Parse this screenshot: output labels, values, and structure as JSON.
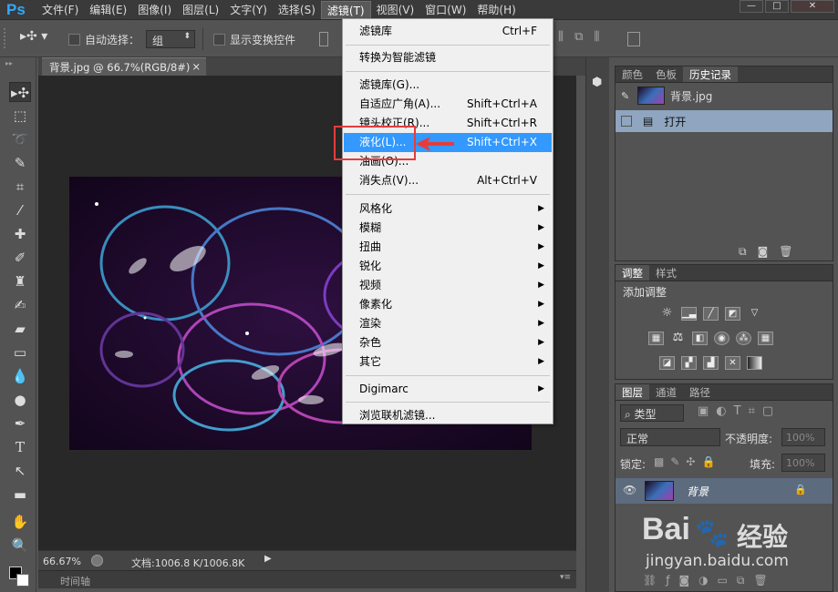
{
  "app": {
    "logo": "Ps"
  },
  "menubar": {
    "items": [
      "文件(F)",
      "编辑(E)",
      "图像(I)",
      "图层(L)",
      "文字(Y)",
      "选择(S)",
      "滤镜(T)",
      "视图(V)",
      "窗口(W)",
      "帮助(H)"
    ],
    "active_index": 6,
    "window_buttons": [
      "—",
      "□",
      "✕"
    ]
  },
  "options_bar": {
    "auto_select_label": "自动选择：",
    "auto_select_value": "组",
    "show_transform_label": "显示变换控件"
  },
  "document": {
    "tab_title": "背景.jpg @ 66.7%(RGB/8#)",
    "tab_close": "×",
    "zoom": "66.67%",
    "doc_info": "文档:1006.8 K/1006.8K"
  },
  "timeline": {
    "label": "时间轴"
  },
  "filter_menu": {
    "items": [
      {
        "label": "滤镜库",
        "shortcut": "Ctrl+F"
      },
      {
        "label": "转换为智能滤镜"
      },
      {
        "label": "滤镜库(G)..."
      },
      {
        "label": "自适应广角(A)...",
        "shortcut": "Shift+Ctrl+A"
      },
      {
        "label": "镜头校正(R)...",
        "shortcut": "Shift+Ctrl+R"
      },
      {
        "label": "液化(L)...",
        "shortcut": "Shift+Ctrl+X",
        "highlighted": true
      },
      {
        "label": "油画(O)..."
      },
      {
        "label": "消失点(V)...",
        "shortcut": "Alt+Ctrl+V"
      },
      {
        "label": "风格化",
        "submenu": true
      },
      {
        "label": "模糊",
        "submenu": true
      },
      {
        "label": "扭曲",
        "submenu": true
      },
      {
        "label": "锐化",
        "submenu": true
      },
      {
        "label": "视频",
        "submenu": true
      },
      {
        "label": "像素化",
        "submenu": true
      },
      {
        "label": "渲染",
        "submenu": true
      },
      {
        "label": "杂色",
        "submenu": true
      },
      {
        "label": "其它",
        "submenu": true
      },
      {
        "label": "Digimarc",
        "submenu": true
      },
      {
        "label": "浏览联机滤镜..."
      }
    ]
  },
  "history_panel": {
    "tabs": [
      "颜色",
      "色板",
      "历史记录"
    ],
    "active_tab": 2,
    "snapshot_label": "背景.jpg",
    "entries": [
      "打开"
    ]
  },
  "adjustments_panel": {
    "tabs": [
      "调整",
      "样式"
    ],
    "active_tab": 0,
    "title": "添加调整"
  },
  "layers_panel": {
    "tabs": [
      "图层",
      "通道",
      "路径"
    ],
    "active_tab": 0,
    "filter_kind": "类型",
    "blend_mode": "正常",
    "opacity_label": "不透明度:",
    "opacity_value": "100%",
    "lock_label": "锁定:",
    "fill_label": "填充:",
    "fill_value": "100%",
    "layer_name": "背景"
  },
  "watermark": {
    "brand_left": "Bai",
    "brand_right": "经验",
    "url": "jingyan.baidu.com"
  },
  "colors": {
    "highlight": "#3399ff",
    "annotation": "#e63c3c",
    "panel_bg": "#535353",
    "dark_bg": "#282828"
  }
}
